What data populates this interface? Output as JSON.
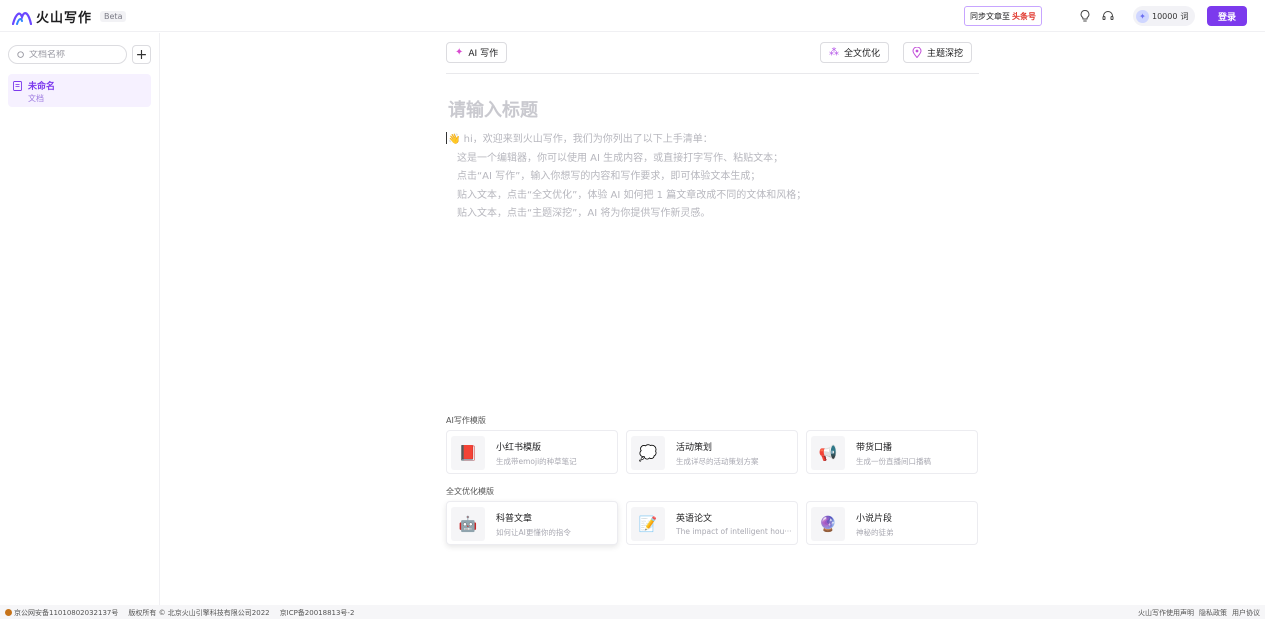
{
  "header": {
    "app_name": "火山写作",
    "beta_label": "Beta",
    "sync_text": "同步文章至",
    "sync_brand": "头条号",
    "credits_value": "10000",
    "credits_unit": "词",
    "login_label": "登录"
  },
  "sidebar": {
    "search_placeholder": "文档名称",
    "add_label": "+",
    "documents": [
      {
        "title": "未命名",
        "subtitle": "文档"
      }
    ]
  },
  "editor": {
    "ai_write_label": "AI 写作",
    "optimize_label": "全文优化",
    "topic_label": "主题深挖",
    "title_placeholder": "请输入标题",
    "intro_lines": [
      "👋 hi，欢迎来到火山写作，我们为你列出了以下上手清单：",
      "这是一个编辑器，你可以使用 AI 生成内容，或直接打字写作、粘贴文本；",
      "点击“AI 写作”，输入你想写的内容和写作要求，即可体验文本生成；",
      "贴入文本，点击“全文优化”，体验 AI 如何把 1 篇文章改成不同的文体和风格；",
      "贴入文本，点击“主题深挖”，AI 将为你提供写作新灵感。"
    ]
  },
  "templates": {
    "ai_section_label": "AI写作模版",
    "ai_cards": [
      {
        "icon": "red-book-icon",
        "glyph": "📕",
        "title": "小红书模版",
        "desc": "生成带emoji的种草笔记"
      },
      {
        "icon": "speech-bubble-icon",
        "glyph": "💭",
        "title": "活动策划",
        "desc": "生成详尽的活动策划方案"
      },
      {
        "icon": "megaphone-icon",
        "glyph": "📢",
        "title": "带货口播",
        "desc": "生成一份直播间口播稿"
      }
    ],
    "opt_section_label": "全文优化模版",
    "opt_cards": [
      {
        "icon": "robot-icon",
        "glyph": "🤖",
        "title": "科普文章",
        "desc": "如何让AI更懂你的指令"
      },
      {
        "icon": "memo-icon",
        "glyph": "📝",
        "title": "英语论文",
        "desc": "The impact of intelligent hou···"
      },
      {
        "icon": "crystal-ball-icon",
        "glyph": "🔮",
        "title": "小说片段",
        "desc": "神秘的徒弟"
      }
    ]
  },
  "footer": {
    "police_record": "京公网安备11010802032137号",
    "copyright": "版权所有 © 北京火山引擎科技有限公司2022",
    "icp": "京ICP备20018813号-2",
    "links": [
      "火山写作使用声明",
      "隐私政策",
      "用户协议"
    ]
  },
  "colors": {
    "accent": "#7c3aed",
    "brand_red": "#e0362c",
    "doc_item_bg": "#f6f1ff"
  }
}
